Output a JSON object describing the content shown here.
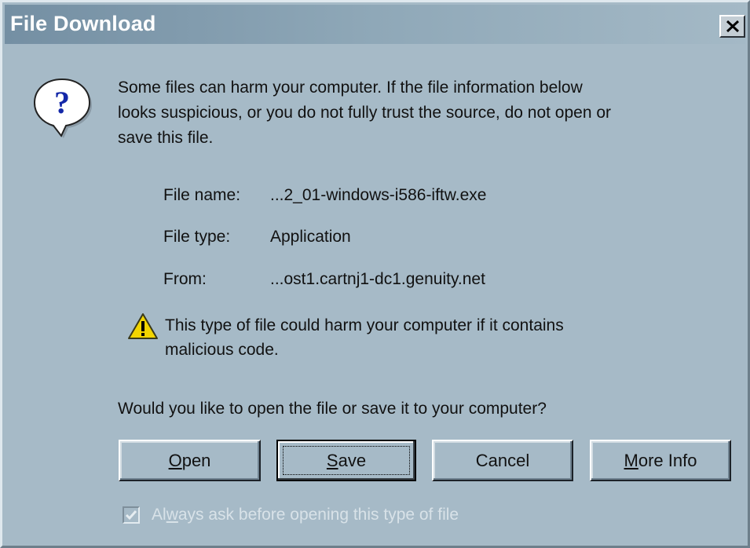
{
  "window": {
    "title": "File Download"
  },
  "message": {
    "line1": "Some files can harm your computer. If the file information below",
    "line2": "looks suspicious, or you do not fully trust the source, do not open or",
    "line3": "save this file."
  },
  "file_info": {
    "name_label": "File name:",
    "name_value": "...2_01-windows-i586-iftw.exe",
    "type_label": "File type:",
    "type_value": "Application",
    "from_label": "From:",
    "from_value": "...ost1.cartnj1-dc1.genuity.net"
  },
  "warning": {
    "line1": "This type of file could harm your computer if it contains",
    "line2": "malicious code."
  },
  "question": "Would you like to open the file or save it to your computer?",
  "buttons": {
    "open": {
      "mnemonic": "O",
      "rest": "pen"
    },
    "save": {
      "mnemonic": "S",
      "rest": "ave"
    },
    "cancel": "Cancel",
    "more_info": {
      "mnemonic": "M",
      "rest": "ore Info"
    }
  },
  "checkbox": {
    "checked": true,
    "enabled": false,
    "label_prefix": "Al",
    "label_mnemonic": "w",
    "label_rest": "ays ask before opening this type of file"
  },
  "icons": {
    "dialog_icon": "question-balloon-icon",
    "warning_icon": "warning-triangle-icon",
    "close_icon": "close-x-icon",
    "check_icon": "checkmark-icon"
  },
  "colors": {
    "dialog_background": "#a6bac7",
    "title_bar_start": "#748fa3",
    "title_bar_end": "#a4b9c6",
    "title_text": "#ffffff",
    "warning_yellow": "#f2d500",
    "question_blue": "#1428a8"
  }
}
